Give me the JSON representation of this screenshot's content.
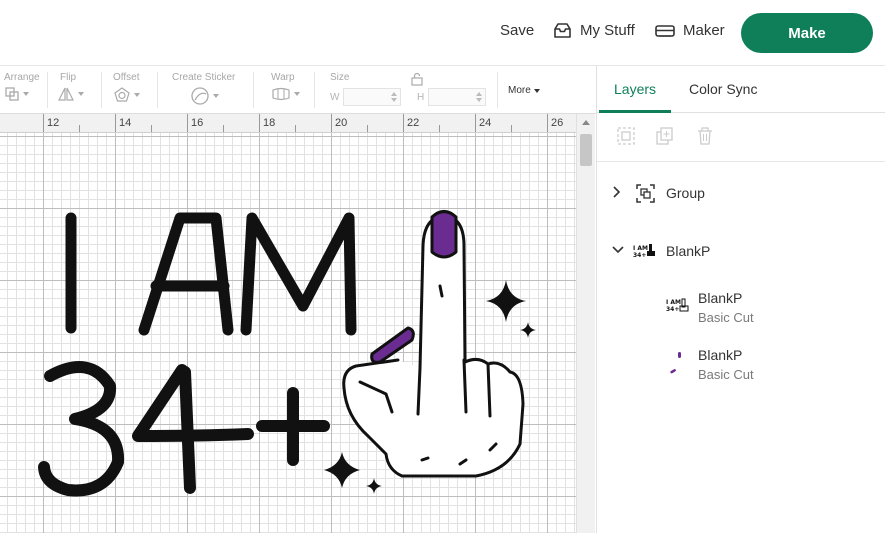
{
  "header": {
    "save_label": "Save",
    "mystuff_label": "My Stuff",
    "maker_label": "Maker",
    "make_label": "Make",
    "accent": "#0f7f5a"
  },
  "toolbar": {
    "arrange": "Arrange",
    "flip": "Flip",
    "offset": "Offset",
    "create_sticker": "Create Sticker",
    "warp": "Warp",
    "size": "Size",
    "w_label": "W",
    "h_label": "H",
    "more": "More"
  },
  "ruler": {
    "ticks": [
      "12",
      "14",
      "16",
      "18",
      "20",
      "22",
      "24",
      "26"
    ]
  },
  "design": {
    "line1": "I AM",
    "line2": "34+",
    "nail_color": "#6a2c91"
  },
  "panel": {
    "tabs": [
      "Layers",
      "Color Sync"
    ],
    "active_tab": "Layers",
    "layers": [
      {
        "name": "Group",
        "icon": "group-icon"
      },
      {
        "name": "BlankP",
        "icon": "design-thumb"
      }
    ],
    "children": [
      {
        "name": "BlankP",
        "type": "Basic Cut"
      },
      {
        "name": "BlankP",
        "type": "Basic Cut"
      }
    ]
  }
}
